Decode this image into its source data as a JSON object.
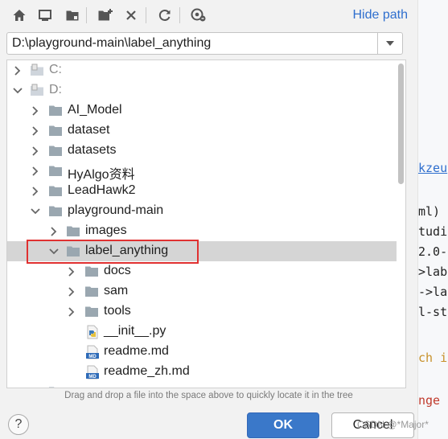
{
  "toolbar": {
    "icons": [
      "home-icon",
      "desktop-icon",
      "project-folder-icon",
      "new-folder-icon",
      "delete-icon",
      "refresh-icon",
      "show-hidden-icon"
    ],
    "hide_path_label": "Hide path"
  },
  "path": {
    "value": "D:\\playground-main\\label_anything"
  },
  "tree": {
    "rows": [
      {
        "label": "C:",
        "kind": "drive",
        "expanded": false
      },
      {
        "label": "D:",
        "kind": "drive",
        "expanded": true
      },
      {
        "label": "AI_Model",
        "kind": "folder",
        "expanded": false
      },
      {
        "label": "dataset",
        "kind": "folder",
        "expanded": false
      },
      {
        "label": "datasets",
        "kind": "folder",
        "expanded": false
      },
      {
        "label": "HyAlgo资料",
        "kind": "folder",
        "expanded": false
      },
      {
        "label": "LeadHawk2",
        "kind": "folder",
        "expanded": false
      },
      {
        "label": "playground-main",
        "kind": "folder",
        "expanded": true
      },
      {
        "label": "images",
        "kind": "folder",
        "expanded": false
      },
      {
        "label": "label_anything",
        "kind": "folder",
        "expanded": true,
        "selected": true
      },
      {
        "label": "docs",
        "kind": "folder",
        "expanded": false
      },
      {
        "label": "sam",
        "kind": "folder",
        "expanded": false
      },
      {
        "label": "tools",
        "kind": "folder",
        "expanded": false
      },
      {
        "label": "__init__.py",
        "kind": "python-file"
      },
      {
        "label": "readme.md",
        "kind": "markdown-file"
      },
      {
        "label": "readme_zh.md",
        "kind": "markdown-file"
      }
    ]
  },
  "hint": "Drag and drop a file into the space above to quickly locate it in the tree",
  "buttons": {
    "help": "?",
    "ok": "OK",
    "cancel": "Cancel"
  },
  "watermark": "CSDN @*Major*",
  "background_editor": {
    "lines": [
      "kzeu",
      "ml)",
      "tudi",
      "2.0-",
      ">lab",
      "->la",
      "l-st",
      "ch i",
      "nge"
    ]
  },
  "colors": {
    "accent": "#3a78c9",
    "link": "#2f6fce",
    "highlight": "#e03131",
    "selected_row": "#d5d5d5"
  }
}
